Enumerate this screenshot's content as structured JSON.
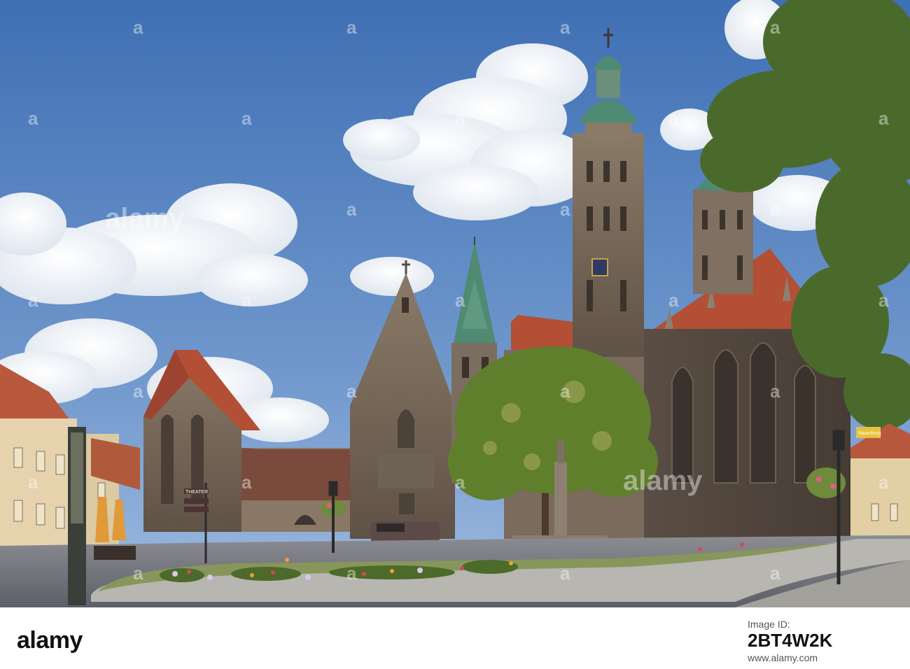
{
  "watermark": {
    "brand": "alamy",
    "repeat_text": "a",
    "color": "#ffffff"
  },
  "scene": {
    "sky_color": "#5f8bc6",
    "roof_color": "#b5513a",
    "stone_color": "#7d6e5f",
    "copper_color": "#4f8a72",
    "tree_color": "#5f7f2d",
    "street_sign_text": "THEATER",
    "shop_sign_text": "Naumburg"
  },
  "footer": {
    "logo_text": "alamy",
    "image_id_label": "Image ID:",
    "image_id": "2BT4W2K",
    "site_url": "www.alamy.com"
  }
}
